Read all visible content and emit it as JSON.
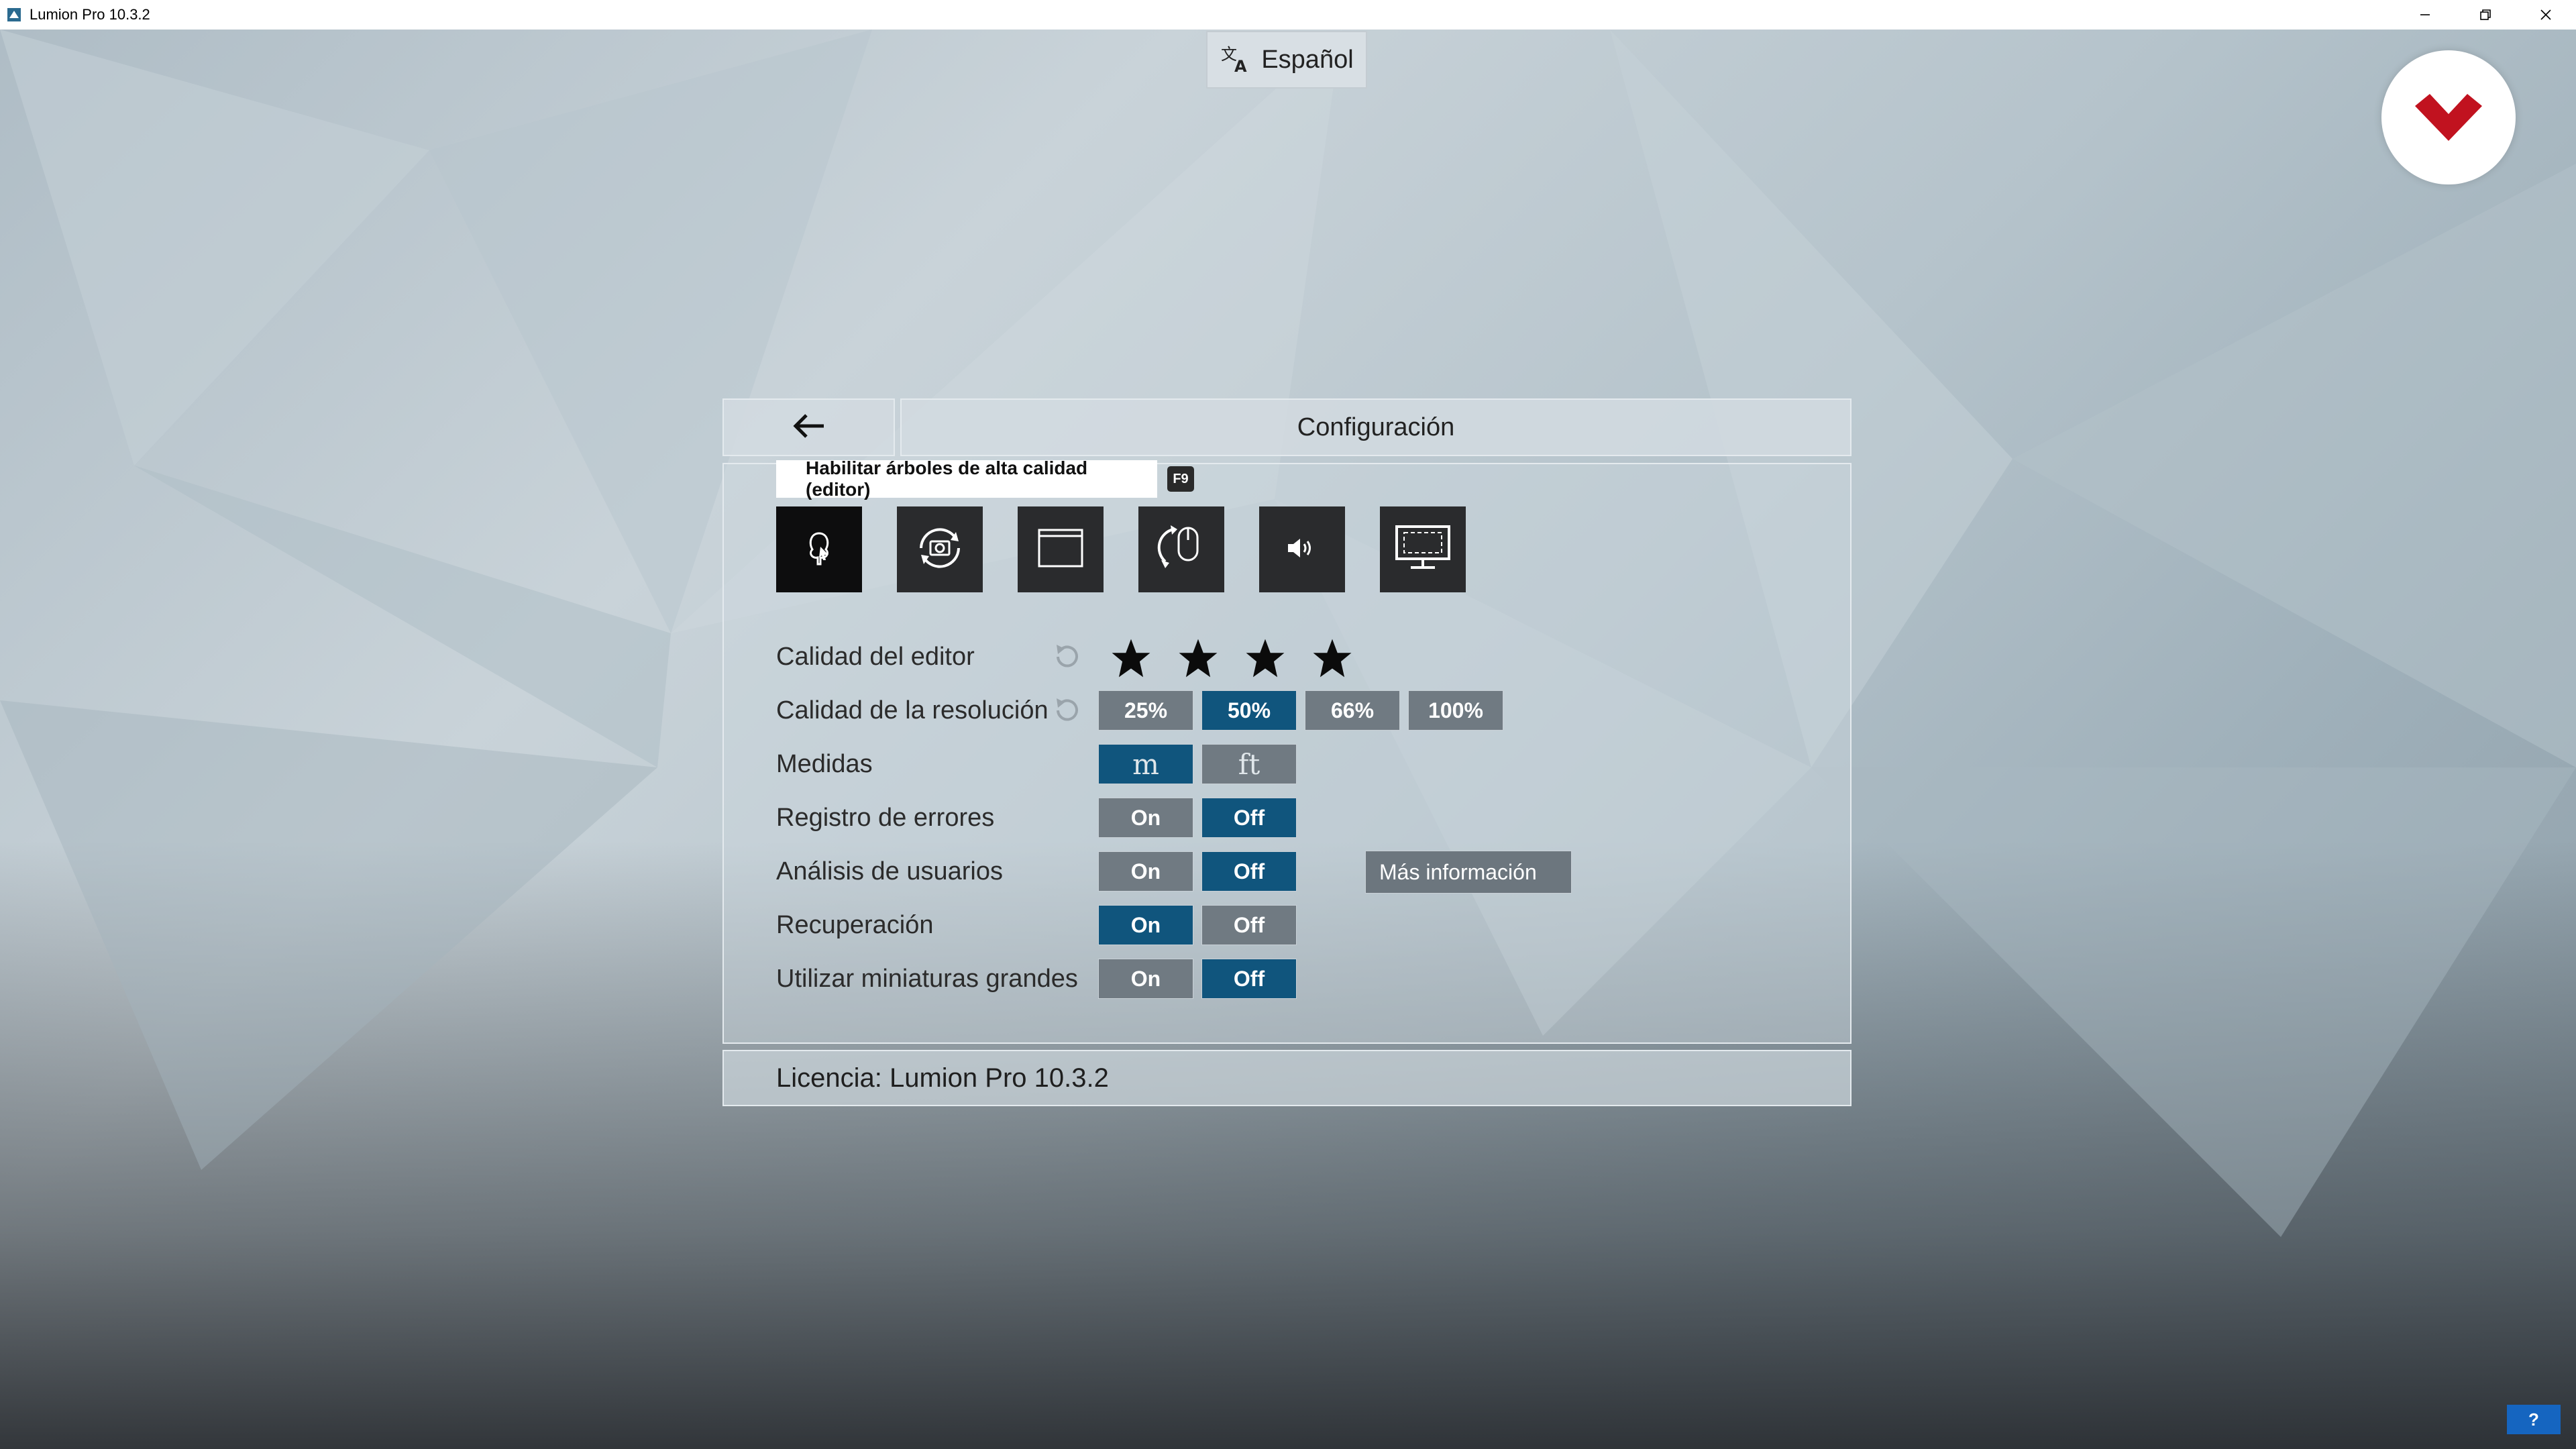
{
  "window": {
    "title": "Lumion Pro 10.3.2",
    "controls": [
      "minimize-icon",
      "restore-icon",
      "close-icon"
    ]
  },
  "language": {
    "label": "Español",
    "icon": "translate-icon"
  },
  "header": {
    "back_icon": "arrow-left-icon",
    "title": "Configuración"
  },
  "tooltip": {
    "text": "Habilitar árboles de alta calidad (editor)",
    "shortcut": "F9"
  },
  "tabs": [
    {
      "name": "tree-quality-icon",
      "active": true
    },
    {
      "name": "camera-rotate-icon",
      "active": false
    },
    {
      "name": "fullscreen-window-icon",
      "active": false
    },
    {
      "name": "mouse-invert-icon",
      "active": false
    },
    {
      "name": "speaker-icon",
      "active": false
    },
    {
      "name": "monitor-icon",
      "active": false
    }
  ],
  "settings": {
    "editor_quality": {
      "label": "Calidad del editor",
      "stars": 4,
      "max_stars": 4
    },
    "resolution": {
      "label": "Calidad de la resolución",
      "options": [
        "25%",
        "50%",
        "66%",
        "100%"
      ],
      "selected": "50%"
    },
    "units": {
      "label": "Medidas",
      "options": [
        "m",
        "ft"
      ],
      "selected": "m"
    },
    "error_log": {
      "label": "Registro de errores",
      "on": "On",
      "off": "Off",
      "selected": "Off"
    },
    "user_analytics": {
      "label": "Análisis de usuarios",
      "on": "On",
      "off": "Off",
      "selected": "Off",
      "more_info": "Más información"
    },
    "recovery": {
      "label": "Recuperación",
      "on": "On",
      "off": "Off",
      "selected": "On"
    },
    "large_thumbnails": {
      "label": "Utilizar miniaturas grandes",
      "on": "On",
      "off": "Off",
      "selected": "Off"
    }
  },
  "license": {
    "text": "Licencia: Lumion Pro 10.3.2"
  },
  "help": {
    "label": "?"
  },
  "colors": {
    "selected": "#10557d",
    "unselected": "#707a82",
    "logo": "#c1121f"
  }
}
